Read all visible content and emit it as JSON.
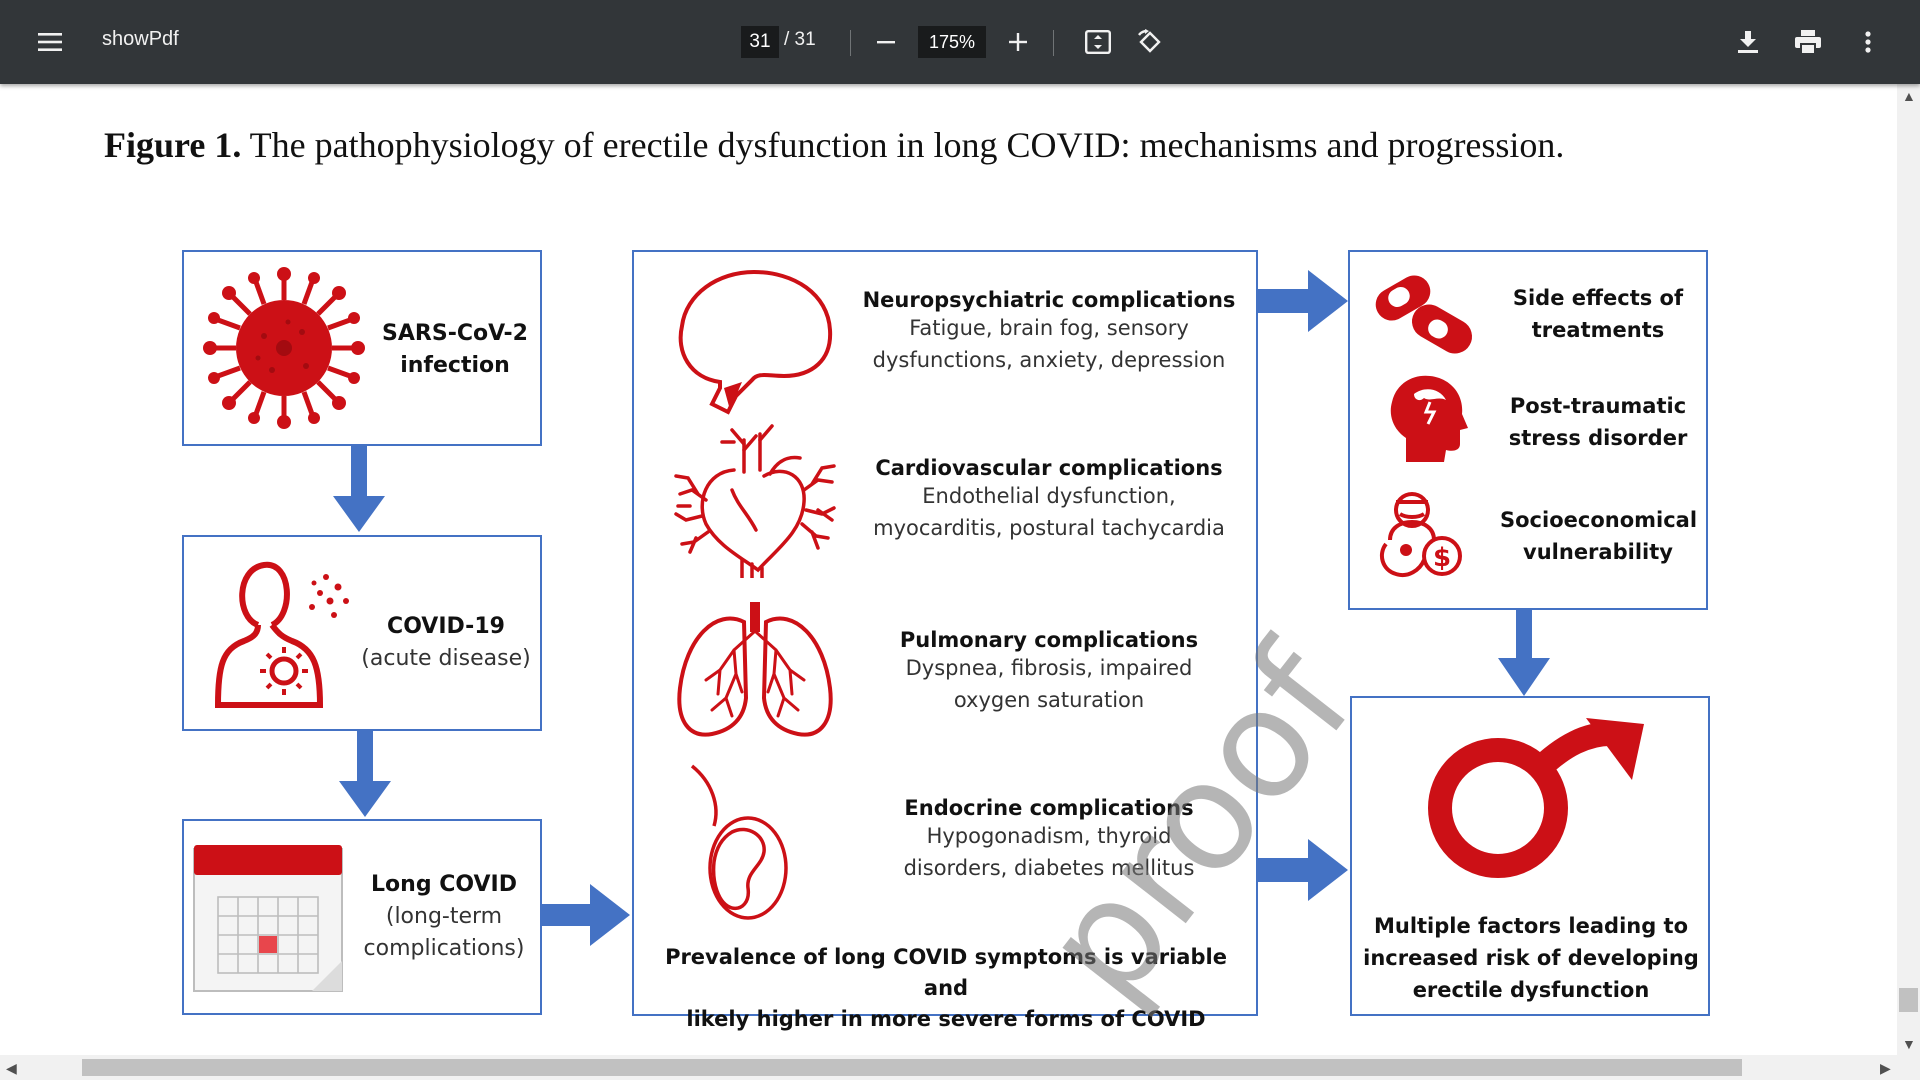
{
  "toolbar": {
    "title": "showPdf",
    "current_page": "31",
    "total_pages": "/ 31",
    "zoom": "175%",
    "icons": [
      "menu-icon",
      "minus-icon",
      "plus-icon",
      "fit-page-icon",
      "rotate-icon",
      "download-icon",
      "print-icon",
      "more-vert-icon"
    ]
  },
  "figure": {
    "caption_label": "Figure 1.",
    "caption_text": " The pathophysiology of erectile dysfunction in long COVID: mechanisms and progression.",
    "left_column": [
      {
        "title": "SARS-CoV-2",
        "title2": "infection"
      },
      {
        "title": "COVID-19",
        "sub": "(acute disease)"
      },
      {
        "title": "Long COVID",
        "sub": "(long-term",
        "sub2": "complications)"
      }
    ],
    "middle": [
      {
        "title": "Neuropsychiatric complications",
        "lines": [
          "Fatigue, brain fog, sensory",
          "dysfunctions, anxiety, depression"
        ]
      },
      {
        "title": "Cardiovascular complications",
        "lines": [
          "Endothelial dysfunction,",
          "myocarditis, postural tachycardia"
        ]
      },
      {
        "title": "Pulmonary complications",
        "lines": [
          "Dyspnea, fibrosis, impaired",
          "oxygen saturation"
        ]
      },
      {
        "title": "Endocrine complications",
        "lines": [
          "Hypogonadism, thyroid",
          "disorders, diabetes mellitus"
        ]
      }
    ],
    "middle_footer": [
      "Prevalence of long COVID symptoms is variable and",
      "likely higher in more severe forms of COVID"
    ],
    "right_top": [
      {
        "line1": "Side effects of",
        "line2": "treatments"
      },
      {
        "line1": "Post-traumatic",
        "line2": "stress disorder"
      },
      {
        "line1": "Socioeconomical",
        "line2": "vulnerability"
      }
    ],
    "right_bottom": [
      "Multiple factors leading to",
      "increased risk of developing",
      "erectile dysfunction"
    ],
    "watermark": "proof",
    "colors": {
      "red": "#cc1016",
      "blue": "#4472c4",
      "arrow": "#4472c4"
    }
  }
}
